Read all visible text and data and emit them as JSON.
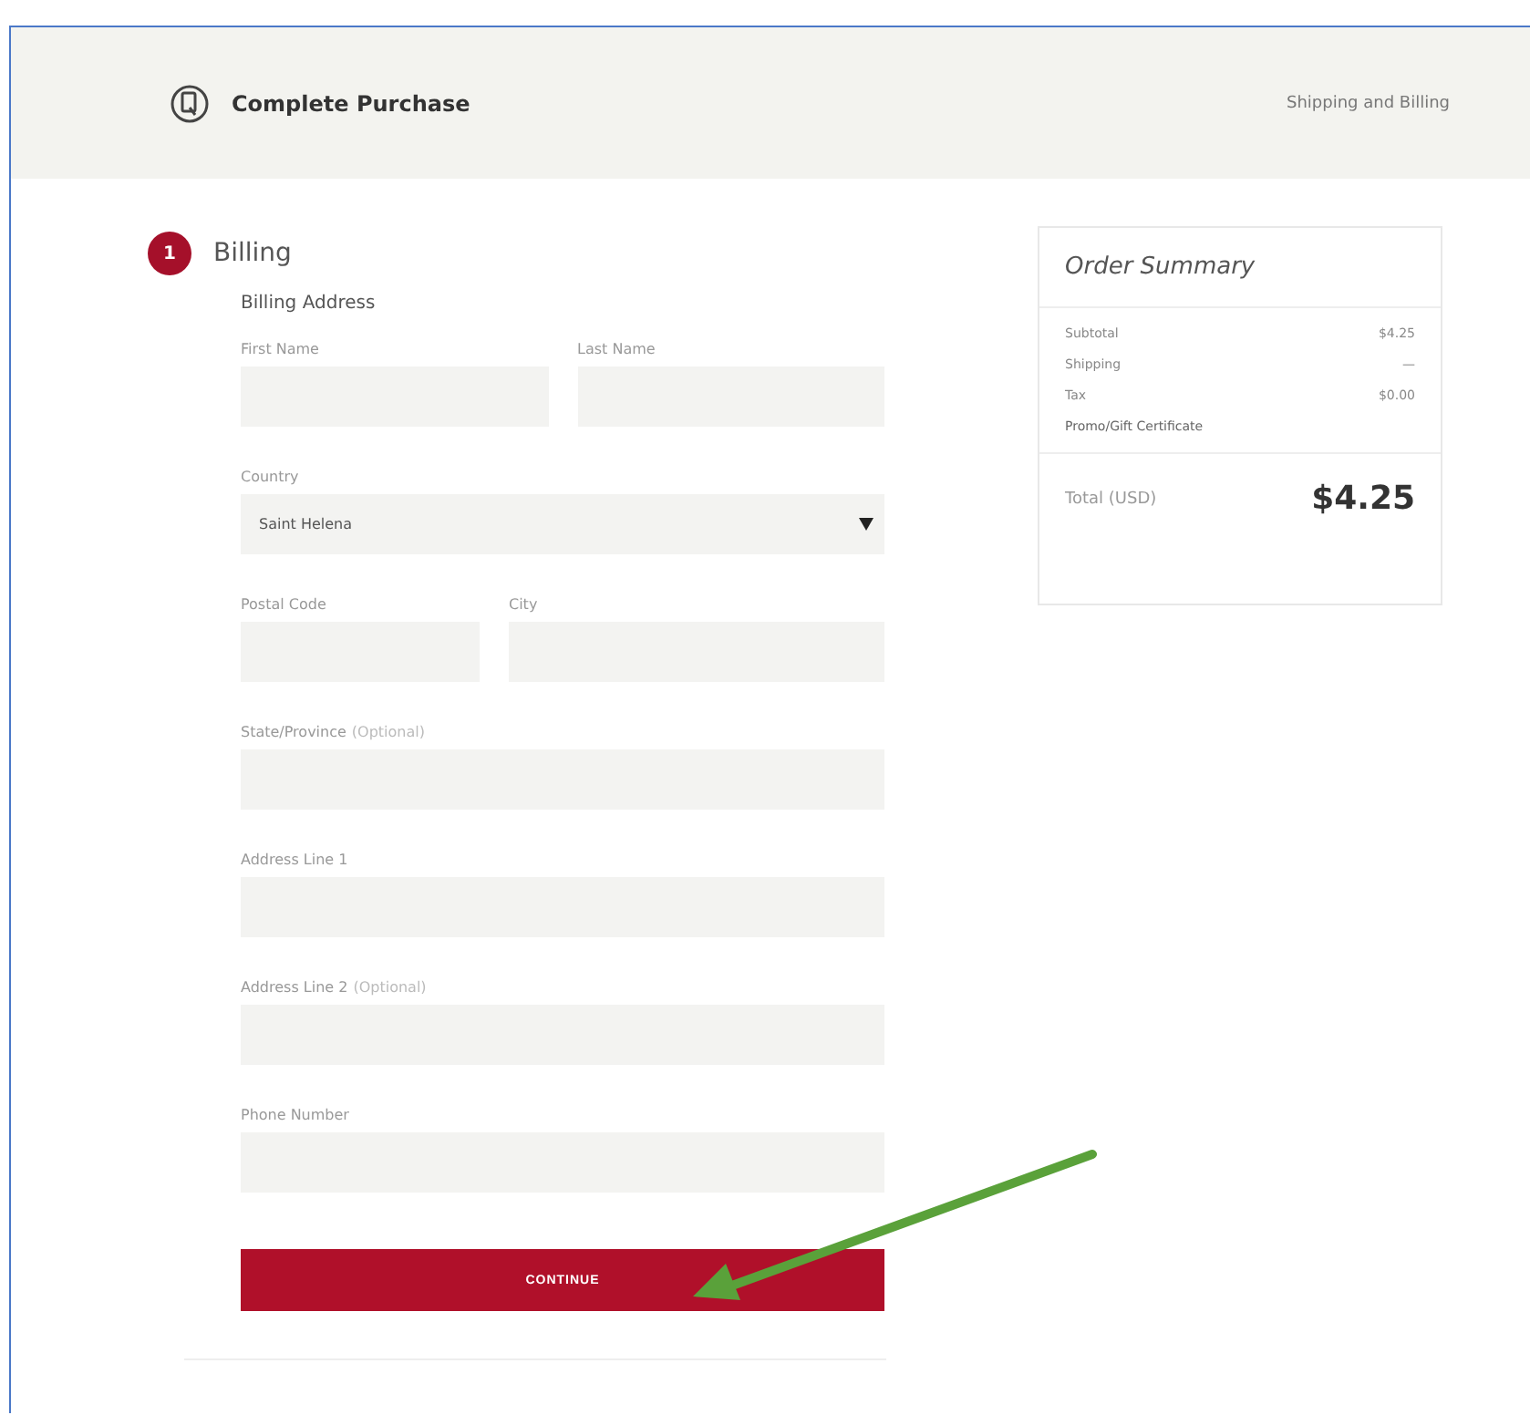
{
  "header": {
    "title": "Complete Purchase",
    "step_link": "Shipping and Billing"
  },
  "step": {
    "number": "1",
    "title": "Billing",
    "subtitle": "Billing Address"
  },
  "rows": [
    [
      {
        "label": "First Name"
      },
      {
        "label": "Last Name"
      }
    ],
    [
      {
        "label": "Country",
        "kind": "select",
        "value": "Saint Helena"
      }
    ],
    [
      {
        "label": "Postal Code",
        "kind": "short"
      },
      {
        "label": "City"
      }
    ],
    [
      {
        "label": "State/Province",
        "optional": "(Optional)"
      }
    ],
    [
      {
        "label": "Address Line 1"
      }
    ],
    [
      {
        "label": "Address Line 2",
        "optional": "(Optional)"
      }
    ],
    [
      {
        "label": "Phone Number"
      }
    ]
  ],
  "button": "CONTINUE",
  "summary": {
    "title": "Order Summary",
    "lines": [
      {
        "label": "Subtotal",
        "value": "$4.25"
      },
      {
        "label": "Shipping",
        "value": "—"
      },
      {
        "label": "Tax",
        "value": "$0.00"
      },
      {
        "label": "Promo/Gift Certificate"
      }
    ],
    "total_label": "Total (USD)",
    "total": "$4.25"
  }
}
